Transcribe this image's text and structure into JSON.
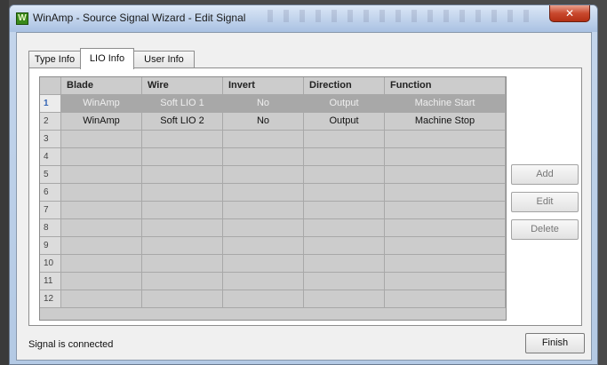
{
  "window": {
    "title": "WinAmp - Source Signal Wizard - Edit Signal",
    "icon_letter": "W",
    "close_glyph": "✕"
  },
  "tabs": [
    {
      "label": "Type Info",
      "active": false
    },
    {
      "label": "LIO Info",
      "active": true
    },
    {
      "label": "User Info",
      "active": false
    }
  ],
  "grid": {
    "columns": [
      "",
      "Blade",
      "Wire",
      "Invert",
      "Direction",
      "Function"
    ],
    "rows": [
      {
        "num": "1",
        "blade": "WinAmp",
        "wire": "Soft LIO 1",
        "invert": "No",
        "direction": "Output",
        "function": "Machine Start",
        "selected": true
      },
      {
        "num": "2",
        "blade": "WinAmp",
        "wire": "Soft LIO 2",
        "invert": "No",
        "direction": "Output",
        "function": "Machine Stop",
        "selected": false
      },
      {
        "num": "3",
        "blade": "",
        "wire": "",
        "invert": "",
        "direction": "",
        "function": "",
        "selected": false
      },
      {
        "num": "4",
        "blade": "",
        "wire": "",
        "invert": "",
        "direction": "",
        "function": "",
        "selected": false
      },
      {
        "num": "5",
        "blade": "",
        "wire": "",
        "invert": "",
        "direction": "",
        "function": "",
        "selected": false
      },
      {
        "num": "6",
        "blade": "",
        "wire": "",
        "invert": "",
        "direction": "",
        "function": "",
        "selected": false
      },
      {
        "num": "7",
        "blade": "",
        "wire": "",
        "invert": "",
        "direction": "",
        "function": "",
        "selected": false
      },
      {
        "num": "8",
        "blade": "",
        "wire": "",
        "invert": "",
        "direction": "",
        "function": "",
        "selected": false
      },
      {
        "num": "9",
        "blade": "",
        "wire": "",
        "invert": "",
        "direction": "",
        "function": "",
        "selected": false
      },
      {
        "num": "10",
        "blade": "",
        "wire": "",
        "invert": "",
        "direction": "",
        "function": "",
        "selected": false
      },
      {
        "num": "11",
        "blade": "",
        "wire": "",
        "invert": "",
        "direction": "",
        "function": "",
        "selected": false
      },
      {
        "num": "12",
        "blade": "",
        "wire": "",
        "invert": "",
        "direction": "",
        "function": "",
        "selected": false
      }
    ]
  },
  "buttons": {
    "add": "Add",
    "edit": "Edit",
    "delete": "Delete",
    "finish": "Finish"
  },
  "status": "Signal is connected"
}
